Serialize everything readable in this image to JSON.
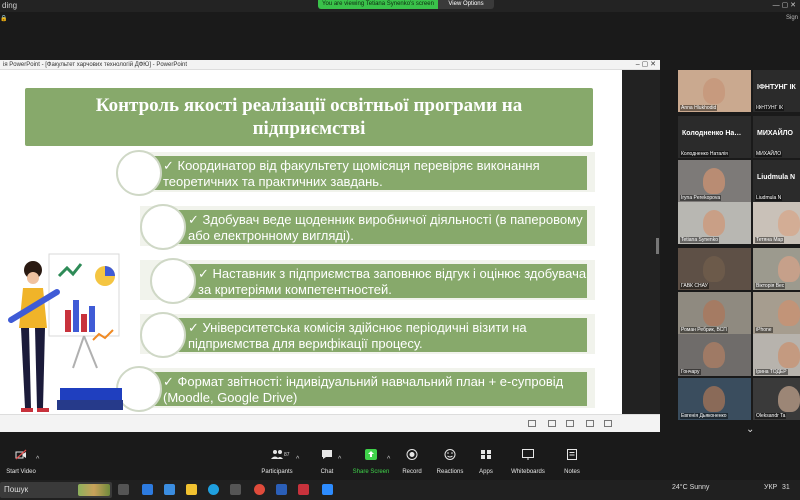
{
  "topbar": {
    "left_text": "ding",
    "viewing": "You are viewing Tetiana Synenko's screen",
    "view_options": "View Options",
    "window_controls": "—  ▢  ✕",
    "app_status": "🔒",
    "app_sign": "Sign"
  },
  "ppt": {
    "window_title": "ія PowerPoint - [Факультет харчових технологій ДФЮ] - PowerPoint",
    "controls": "–  ▢  ✕"
  },
  "slide": {
    "title_line1": "Контроль якості реалізації освітньої програми на",
    "title_line2": "підприємстві",
    "items": [
      {
        "line1": "✓ Координатор від факультету щомісяця перевіряє виконання",
        "line2": "теоретичних та практичних завдань."
      },
      {
        "line1": "✓ Здобувач веде щоденник виробничої діяльності (в паперовому",
        "line2": "або електронному вигляді)."
      },
      {
        "line1": "✓ Наставник з підприємства заповнює відгук і оцінює здобувача",
        "line2": "за критеріями компетентностей."
      },
      {
        "line1": "✓ Університетська комісія здійснює періодичні візити на",
        "line2": "підприємства для верифікації процесу."
      },
      {
        "line1": "✓ Формат звітності: індивідуальний навчальний план + е-супровід",
        "line2": "(Moodle, Google Drive)"
      }
    ]
  },
  "participants": [
    {
      "name": "Anna Hlukhodid",
      "big": "",
      "kind": "video",
      "face": "#c79a7e",
      "bg": "#caa98f"
    },
    {
      "name": "ІФНТУНГ ІК",
      "big": "ІФНТУНГ ІК",
      "kind": "name",
      "face": "",
      "bg": "#2b2b2b"
    },
    {
      "name": "Колодненко Наталія",
      "big": "Колодненко  На…",
      "kind": "name",
      "face": "",
      "bg": "#2b2b2b"
    },
    {
      "name": "МИХАЙЛО",
      "big": "МИХАЙЛО",
      "kind": "name",
      "face": "",
      "bg": "#2b2b2b"
    },
    {
      "name": "Iryna Perekopova",
      "big": "",
      "kind": "video",
      "face": "#b98c73",
      "bg": "#7d7a78"
    },
    {
      "name": "Liudmula N",
      "big": "Liudmula  N",
      "kind": "name",
      "face": "",
      "bg": "#2b2b2b"
    },
    {
      "name": "Tetiana Synenko",
      "big": "",
      "kind": "video",
      "face": "#c99f86",
      "bg": "#b8b7b2"
    },
    {
      "name": "Тетяна Мар",
      "big": "",
      "kind": "video",
      "face": "#d3ad95",
      "bg": "#c9c1b8"
    },
    {
      "name": "ГАВК СНАУ",
      "big": "",
      "kind": "video",
      "face": "#6c5a4a",
      "bg": "#5e5046"
    },
    {
      "name": "Вікторія Вес",
      "big": "",
      "kind": "video",
      "face": "#c6a08a",
      "bg": "#9c9a8e"
    },
    {
      "name": "Роман Ребрик, ВСП",
      "big": "",
      "kind": "video",
      "face": "#a57b63",
      "bg": "#8f8a80"
    },
    {
      "name": "iPhone",
      "big": "",
      "kind": "video",
      "face": "#c29478",
      "bg": "#a69d8f"
    },
    {
      "name": "Гончару",
      "big": "",
      "kind": "video",
      "face": "#9f7a65",
      "bg": "#6f6c6a"
    },
    {
      "name": "Ірина ТОДЕР",
      "big": "",
      "kind": "video",
      "face": "#c49a80",
      "bg": "#b7b3ad"
    },
    {
      "name": "Евгенія Дьяконенко",
      "big": "",
      "kind": "video",
      "face": "#8a6a58",
      "bg": "#3a4d5e"
    },
    {
      "name": "Oleksandr Ta",
      "big": "",
      "kind": "video",
      "face": "#9c8676",
      "bg": "#3a3a3a"
    }
  ],
  "panel": {
    "chevron": "⌄"
  },
  "toolbar": {
    "start_video": "Start Video",
    "participants": "Participants",
    "participants_count": "87",
    "chat": "Chat",
    "share_screen": "Share Screen",
    "record": "Record",
    "reactions": "Reactions",
    "apps": "Apps",
    "whiteboards": "Whiteboards",
    "notes": "Notes",
    "caret": "^"
  },
  "taskbar": {
    "search": "Пошук",
    "weather": "24°C  Sunny",
    "lang": "УКР",
    "time": "31"
  },
  "colors": {
    "slide_green": "#87a96b",
    "share_green": "#3fd24a"
  }
}
